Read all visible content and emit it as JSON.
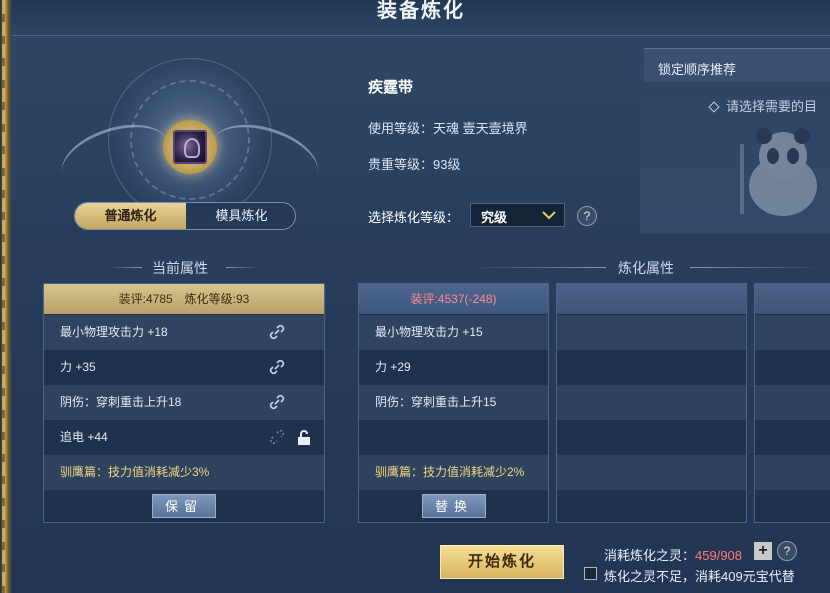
{
  "window": {
    "title": "装备炼化"
  },
  "mode_tabs": [
    {
      "label": "普通炼化",
      "active": true
    },
    {
      "label": "模具炼化",
      "active": false
    }
  ],
  "item": {
    "name": "疾霆带",
    "use_level": "使用等级：天魂 壹天壹境界",
    "rarity_level": "贵重等级：93级",
    "icon": "belt-item-icon"
  },
  "refine_level": {
    "label": "选择炼化等级：",
    "selected": "究级",
    "help": "?"
  },
  "recommend": {
    "title": "锁定顺序推荐",
    "hint": "请选择需要的目"
  },
  "sections": {
    "current_title": "当前属性",
    "refine_title": "炼化属性"
  },
  "current": {
    "header": "装评:4785　炼化等级:93",
    "rows": [
      "最小物理攻击力 +18",
      "力 +35",
      "阴伤：穿刺重击上升18",
      "追电 +44",
      "驯鹰篇：技力值消耗减少3%"
    ],
    "button": "保留"
  },
  "refine": {
    "header": "装评:4537(-248)",
    "rows": [
      "最小物理攻击力 +15",
      "力 +29",
      "阴伤：穿刺重击上升15",
      "",
      "驯鹰篇：技力值消耗减少2%"
    ],
    "button": "替换"
  },
  "bottom": {
    "start_button": "开始炼化",
    "consume_label": "消耗炼化之灵：",
    "consume_value": "459/908",
    "plus": "+",
    "help": "?",
    "substitute_note": "炼化之灵不足，消耗409元宝代替"
  },
  "colors": {
    "accent_gold": "#d8b460",
    "warning_red": "#ff7a7a",
    "panel_bg": "#283e5c"
  }
}
